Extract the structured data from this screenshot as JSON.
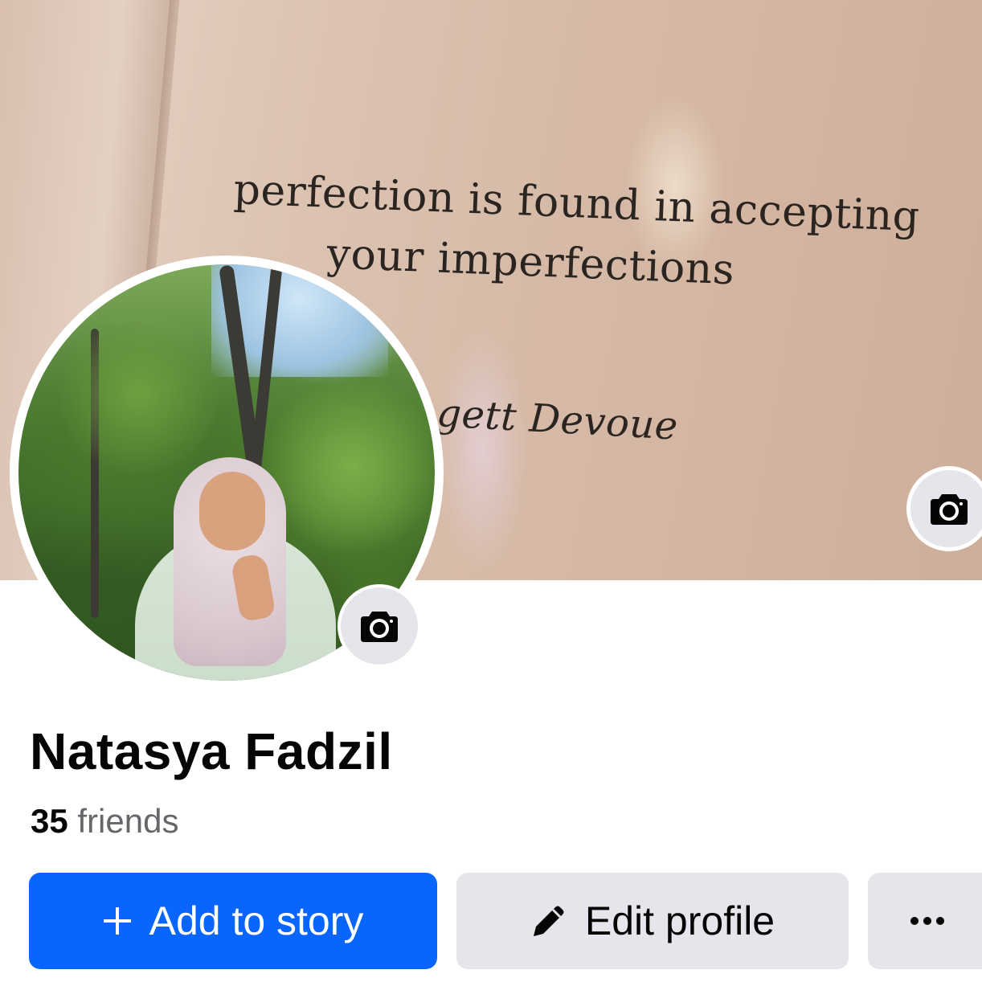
{
  "cover": {
    "quote_line_1": "perfection is found in accepting",
    "quote_line_2": "your imperfections",
    "quote_author": "gett Devoue",
    "camera_icon": "camera-icon"
  },
  "profile": {
    "name": "Natasya Fadzil",
    "friends_count": "35",
    "friends_label": "friends",
    "avatar_camera_icon": "camera-icon"
  },
  "actions": {
    "add_story_label": "Add to story",
    "add_story_icon": "plus-icon",
    "edit_profile_label": "Edit profile",
    "edit_profile_icon": "pencil-icon",
    "more_icon": "more-dots-icon"
  },
  "colors": {
    "primary": "#0866ff",
    "secondary_bg": "#e4e6eb",
    "text": "#050505",
    "muted_text": "#65676b"
  }
}
